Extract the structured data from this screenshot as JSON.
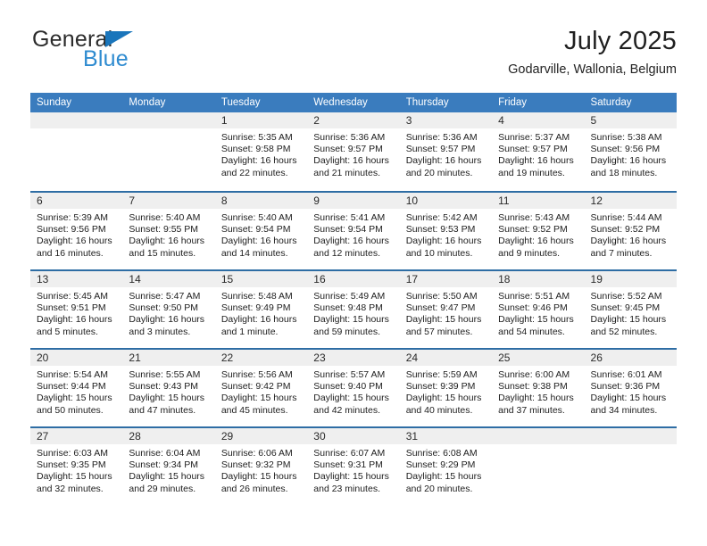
{
  "brand": {
    "name_top": "General",
    "name_bottom": "Blue",
    "triangle_icon": "triangle-icon",
    "color_dark": "#2b2b2b",
    "color_blue": "#2e8bd0"
  },
  "header": {
    "title": "July 2025",
    "location": "Godarville, Wallonia, Belgium"
  },
  "theme": {
    "header_blue": "#3a7cbe",
    "row_divider_blue": "#2e6da4",
    "day_band_gray": "#efefef"
  },
  "calendar": {
    "weekdays": [
      "Sunday",
      "Monday",
      "Tuesday",
      "Wednesday",
      "Thursday",
      "Friday",
      "Saturday"
    ],
    "weeks": [
      [
        {
          "day": "",
          "lines": []
        },
        {
          "day": "",
          "lines": []
        },
        {
          "day": "1",
          "lines": [
            "Sunrise: 5:35 AM",
            "Sunset: 9:58 PM",
            "Daylight: 16 hours",
            "and 22 minutes."
          ]
        },
        {
          "day": "2",
          "lines": [
            "Sunrise: 5:36 AM",
            "Sunset: 9:57 PM",
            "Daylight: 16 hours",
            "and 21 minutes."
          ]
        },
        {
          "day": "3",
          "lines": [
            "Sunrise: 5:36 AM",
            "Sunset: 9:57 PM",
            "Daylight: 16 hours",
            "and 20 minutes."
          ]
        },
        {
          "day": "4",
          "lines": [
            "Sunrise: 5:37 AM",
            "Sunset: 9:57 PM",
            "Daylight: 16 hours",
            "and 19 minutes."
          ]
        },
        {
          "day": "5",
          "lines": [
            "Sunrise: 5:38 AM",
            "Sunset: 9:56 PM",
            "Daylight: 16 hours",
            "and 18 minutes."
          ]
        }
      ],
      [
        {
          "day": "6",
          "lines": [
            "Sunrise: 5:39 AM",
            "Sunset: 9:56 PM",
            "Daylight: 16 hours",
            "and 16 minutes."
          ]
        },
        {
          "day": "7",
          "lines": [
            "Sunrise: 5:40 AM",
            "Sunset: 9:55 PM",
            "Daylight: 16 hours",
            "and 15 minutes."
          ]
        },
        {
          "day": "8",
          "lines": [
            "Sunrise: 5:40 AM",
            "Sunset: 9:54 PM",
            "Daylight: 16 hours",
            "and 14 minutes."
          ]
        },
        {
          "day": "9",
          "lines": [
            "Sunrise: 5:41 AM",
            "Sunset: 9:54 PM",
            "Daylight: 16 hours",
            "and 12 minutes."
          ]
        },
        {
          "day": "10",
          "lines": [
            "Sunrise: 5:42 AM",
            "Sunset: 9:53 PM",
            "Daylight: 16 hours",
            "and 10 minutes."
          ]
        },
        {
          "day": "11",
          "lines": [
            "Sunrise: 5:43 AM",
            "Sunset: 9:52 PM",
            "Daylight: 16 hours",
            "and 9 minutes."
          ]
        },
        {
          "day": "12",
          "lines": [
            "Sunrise: 5:44 AM",
            "Sunset: 9:52 PM",
            "Daylight: 16 hours",
            "and 7 minutes."
          ]
        }
      ],
      [
        {
          "day": "13",
          "lines": [
            "Sunrise: 5:45 AM",
            "Sunset: 9:51 PM",
            "Daylight: 16 hours",
            "and 5 minutes."
          ]
        },
        {
          "day": "14",
          "lines": [
            "Sunrise: 5:47 AM",
            "Sunset: 9:50 PM",
            "Daylight: 16 hours",
            "and 3 minutes."
          ]
        },
        {
          "day": "15",
          "lines": [
            "Sunrise: 5:48 AM",
            "Sunset: 9:49 PM",
            "Daylight: 16 hours",
            "and 1 minute."
          ]
        },
        {
          "day": "16",
          "lines": [
            "Sunrise: 5:49 AM",
            "Sunset: 9:48 PM",
            "Daylight: 15 hours",
            "and 59 minutes."
          ]
        },
        {
          "day": "17",
          "lines": [
            "Sunrise: 5:50 AM",
            "Sunset: 9:47 PM",
            "Daylight: 15 hours",
            "and 57 minutes."
          ]
        },
        {
          "day": "18",
          "lines": [
            "Sunrise: 5:51 AM",
            "Sunset: 9:46 PM",
            "Daylight: 15 hours",
            "and 54 minutes."
          ]
        },
        {
          "day": "19",
          "lines": [
            "Sunrise: 5:52 AM",
            "Sunset: 9:45 PM",
            "Daylight: 15 hours",
            "and 52 minutes."
          ]
        }
      ],
      [
        {
          "day": "20",
          "lines": [
            "Sunrise: 5:54 AM",
            "Sunset: 9:44 PM",
            "Daylight: 15 hours",
            "and 50 minutes."
          ]
        },
        {
          "day": "21",
          "lines": [
            "Sunrise: 5:55 AM",
            "Sunset: 9:43 PM",
            "Daylight: 15 hours",
            "and 47 minutes."
          ]
        },
        {
          "day": "22",
          "lines": [
            "Sunrise: 5:56 AM",
            "Sunset: 9:42 PM",
            "Daylight: 15 hours",
            "and 45 minutes."
          ]
        },
        {
          "day": "23",
          "lines": [
            "Sunrise: 5:57 AM",
            "Sunset: 9:40 PM",
            "Daylight: 15 hours",
            "and 42 minutes."
          ]
        },
        {
          "day": "24",
          "lines": [
            "Sunrise: 5:59 AM",
            "Sunset: 9:39 PM",
            "Daylight: 15 hours",
            "and 40 minutes."
          ]
        },
        {
          "day": "25",
          "lines": [
            "Sunrise: 6:00 AM",
            "Sunset: 9:38 PM",
            "Daylight: 15 hours",
            "and 37 minutes."
          ]
        },
        {
          "day": "26",
          "lines": [
            "Sunrise: 6:01 AM",
            "Sunset: 9:36 PM",
            "Daylight: 15 hours",
            "and 34 minutes."
          ]
        }
      ],
      [
        {
          "day": "27",
          "lines": [
            "Sunrise: 6:03 AM",
            "Sunset: 9:35 PM",
            "Daylight: 15 hours",
            "and 32 minutes."
          ]
        },
        {
          "day": "28",
          "lines": [
            "Sunrise: 6:04 AM",
            "Sunset: 9:34 PM",
            "Daylight: 15 hours",
            "and 29 minutes."
          ]
        },
        {
          "day": "29",
          "lines": [
            "Sunrise: 6:06 AM",
            "Sunset: 9:32 PM",
            "Daylight: 15 hours",
            "and 26 minutes."
          ]
        },
        {
          "day": "30",
          "lines": [
            "Sunrise: 6:07 AM",
            "Sunset: 9:31 PM",
            "Daylight: 15 hours",
            "and 23 minutes."
          ]
        },
        {
          "day": "31",
          "lines": [
            "Sunrise: 6:08 AM",
            "Sunset: 9:29 PM",
            "Daylight: 15 hours",
            "and 20 minutes."
          ]
        },
        {
          "day": "",
          "lines": []
        },
        {
          "day": "",
          "lines": []
        }
      ]
    ]
  }
}
